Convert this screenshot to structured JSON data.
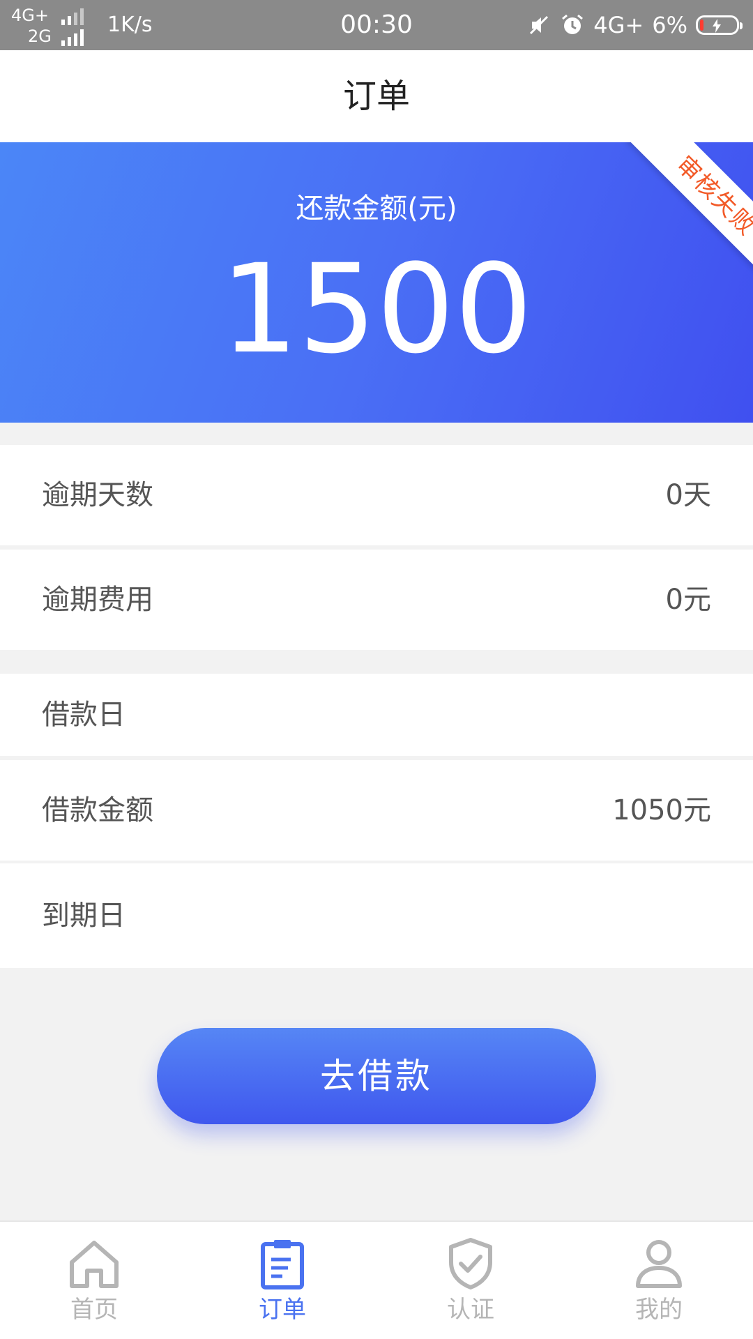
{
  "status_bar": {
    "network_top": "4G+",
    "network_bottom": "2G",
    "speed": "1K/s",
    "time": "00:30",
    "network_right": "4G+",
    "battery": "6%",
    "icons": [
      "mute-icon",
      "alarm-icon",
      "battery-charging-icon"
    ]
  },
  "header": {
    "title": "订单"
  },
  "banner": {
    "label": "还款金额(元)",
    "amount": "1500",
    "ribbon": "审核失败",
    "ribbon_color": "#f25a28",
    "gradient_start": "#4b86f7",
    "gradient_end": "#4050f0"
  },
  "info": {
    "rows": [
      {
        "label": "逾期天数",
        "value": "0天"
      },
      {
        "label": "逾期费用",
        "value": "0元"
      },
      {
        "label": "借款日",
        "value": ""
      },
      {
        "label": "借款金额",
        "value": "1050元"
      },
      {
        "label": "到期日",
        "value": ""
      }
    ]
  },
  "action": {
    "button_label": "去借款"
  },
  "nav": {
    "items": [
      {
        "label": "首页",
        "icon": "home-icon",
        "active": false
      },
      {
        "label": "订单",
        "icon": "order-clipboard-icon",
        "active": true
      },
      {
        "label": "认证",
        "icon": "shield-check-icon",
        "active": false
      },
      {
        "label": "我的",
        "icon": "user-icon",
        "active": false
      }
    ],
    "active_color": "#4a72f0",
    "inactive_color": "#b5b5b5"
  }
}
